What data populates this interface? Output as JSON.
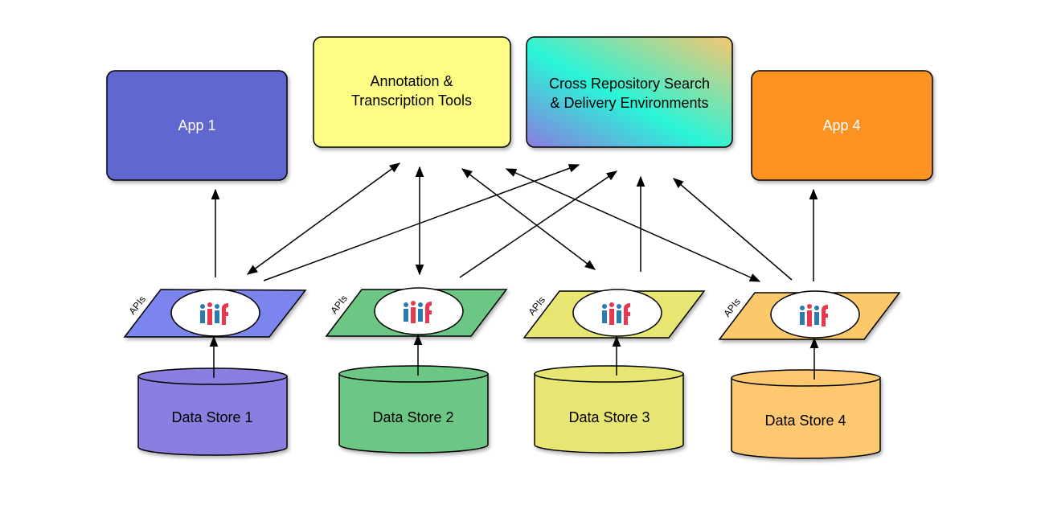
{
  "apps": [
    {
      "label": "App 1",
      "color": "#6068d0"
    },
    {
      "label_lines": [
        "Annotation &",
        "Transcription Tools"
      ],
      "color": "#fdfd86"
    },
    {
      "label_lines": [
        "Cross Repository Search",
        "& Delivery Environments"
      ],
      "gradient": [
        "#8a7be0",
        "#2af5d8",
        "#f7c66e"
      ]
    },
    {
      "label": "App 4",
      "color": "#fc9222"
    }
  ],
  "api_layers": [
    {
      "label": "APIs",
      "logo": "iiif",
      "color": "#7b84ee"
    },
    {
      "label": "APIs",
      "logo": "iiif",
      "color": "#6cc784"
    },
    {
      "label": "APIs",
      "logo": "iiif",
      "color": "#e8e672"
    },
    {
      "label": "APIs",
      "logo": "iiif",
      "color": "#fcc96a"
    }
  ],
  "data_stores": [
    {
      "label": "Data Store 1",
      "color": "#8a7fe0"
    },
    {
      "label": "Data Store 2",
      "color": "#6cc784"
    },
    {
      "label": "Data Store 3",
      "color": "#e8e672"
    },
    {
      "label": "Data Store 4",
      "color": "#fdc870"
    }
  ],
  "logo_colors": {
    "blue": "#2a7bb0",
    "red": "#e8384f"
  }
}
